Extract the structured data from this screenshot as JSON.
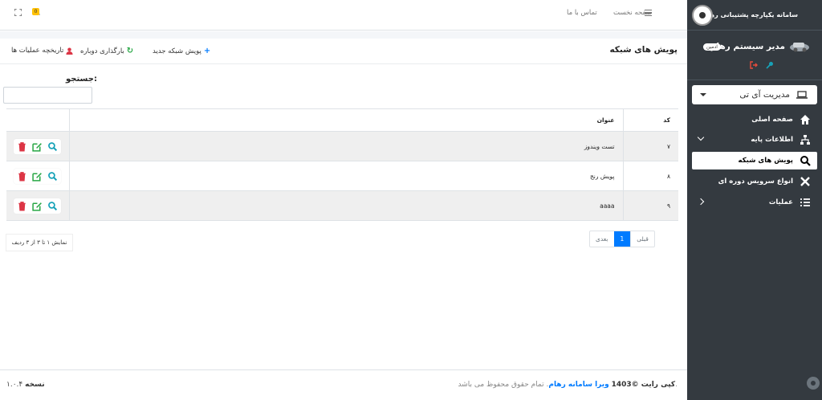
{
  "app": {
    "title": "سامانه یکپارچه پشتیبانی رهام",
    "user_name": "مدیر سیستم رهام",
    "user_role": "ادمین"
  },
  "sidebar": {
    "dropdown_label": "مدیریت آی تی",
    "items": [
      {
        "label": "صفحه اصلی",
        "icon": "home-icon"
      },
      {
        "label": "اطلاعات پایه",
        "icon": "sitemap-icon"
      },
      {
        "label": "پویش های شبکه",
        "icon": "search-icon"
      },
      {
        "label": "انواع سرویس دوره ای",
        "icon": "tools-icon"
      },
      {
        "label": "عملیات",
        "icon": "list-icon"
      }
    ]
  },
  "topbar": {
    "home_link": "صفحه نخست",
    "contact_link": "تماس با ما",
    "notification_count": "0"
  },
  "card": {
    "title": "پویش های شبکه",
    "new_scan": "پویش شبکه جدید",
    "reload": "بارگذاری دوباره",
    "history": "تاریخچه عملیات ها",
    "search_label": "جستجو:"
  },
  "table": {
    "headers": {
      "code": "کد",
      "title": "عنوان"
    },
    "rows": [
      {
        "code": "۷",
        "title": "تست ویندوز"
      },
      {
        "code": "۸",
        "title": "پویش رنج"
      },
      {
        "code": "۹",
        "title": "aaaa"
      }
    ]
  },
  "pagination": {
    "prev": "قبلی",
    "current": "1",
    "next": "بعدی",
    "info": "نمایش ۱ تا ۳ از ۳ ردیف"
  },
  "footer": {
    "copyright_prefix": "کپی رایت ©1403",
    "company": "ویرا سامانه رهام",
    "rights": ". تمام حقوق محفوظ می باشد.",
    "version_label": "نسخه",
    "version": "۱.۰.۴"
  },
  "colors": {
    "sidebar_bg": "#343a40",
    "accent": "#007bff",
    "success": "#28a745",
    "danger": "#dc3545"
  }
}
